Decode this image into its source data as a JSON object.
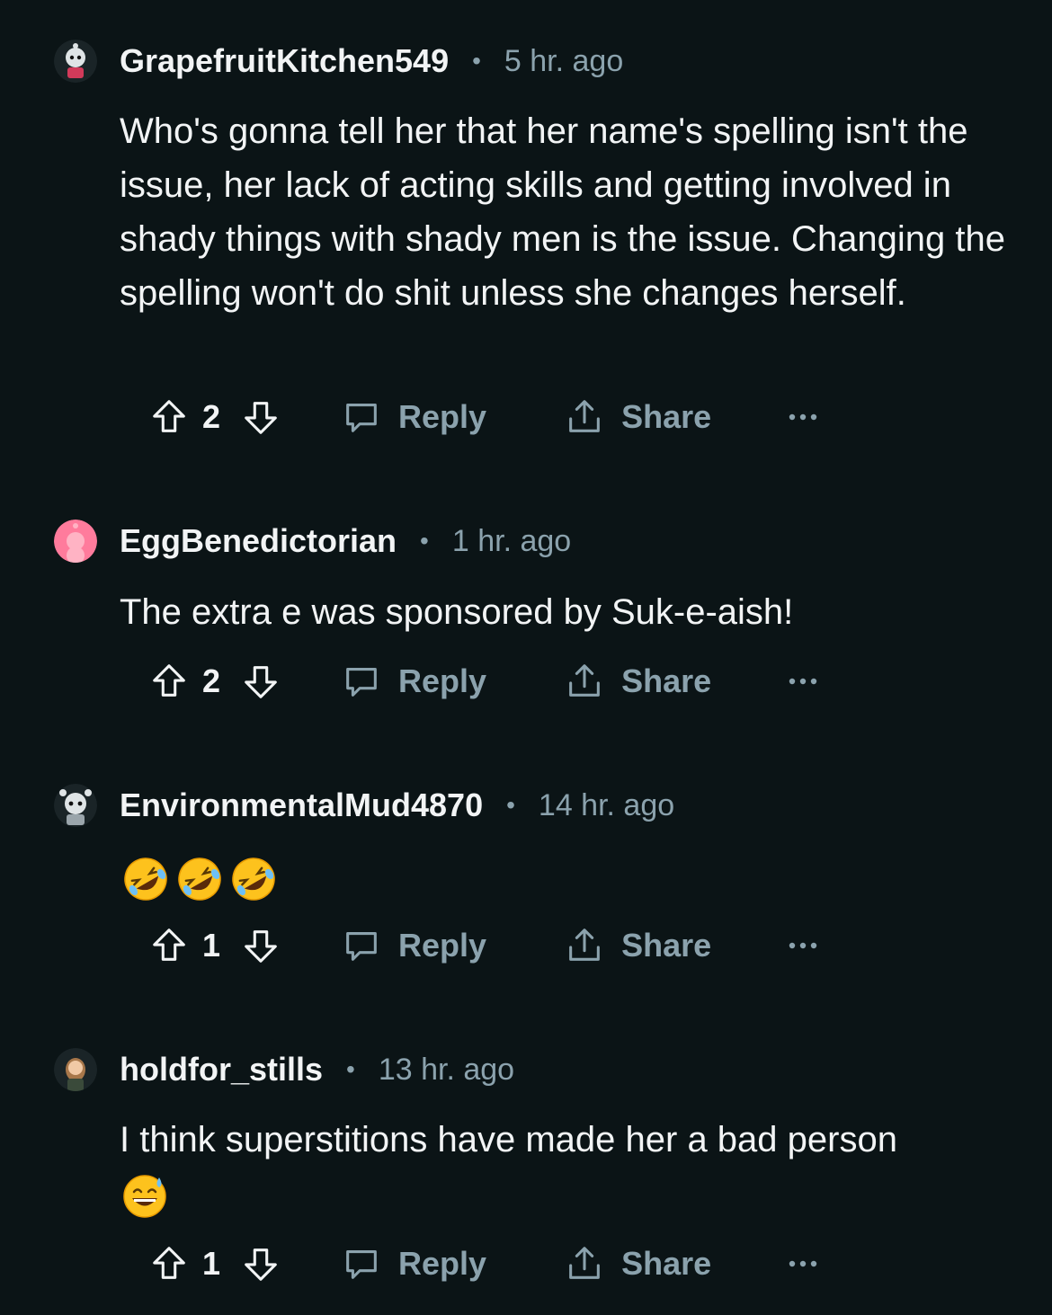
{
  "comments": [
    {
      "username": "GrapefruitKitchen549",
      "time": "5 hr. ago",
      "text": "Who's gonna tell her that her name's spelling isn't the issue, her lack of acting skills and getting involved in shady things with shady men is the issue. Changing the spelling won't do shit unless she changes herself.",
      "score": "2",
      "emojis": []
    },
    {
      "username": "EggBenedictorian",
      "time": "1 hr. ago",
      "text": "The extra e was sponsored by Suk-e-aish!",
      "score": "2",
      "emojis": []
    },
    {
      "username": "EnvironmentalMud4870",
      "time": "14 hr. ago",
      "text": "",
      "score": "1",
      "emojis": [
        "rolling-on-floor-laughing",
        "rolling-on-floor-laughing",
        "rolling-on-floor-laughing"
      ]
    },
    {
      "username": "holdfor_stills",
      "time": "13 hr. ago",
      "text": "I think superstitions have made her a bad person",
      "score": "1",
      "emojis": [
        "grinning-sweat"
      ]
    }
  ],
  "labels": {
    "reply": "Reply",
    "share": "Share",
    "separator": "•"
  },
  "colors": {
    "background": "#0b1416",
    "text": "#f2f4f5",
    "muted": "#8ba2ad"
  }
}
